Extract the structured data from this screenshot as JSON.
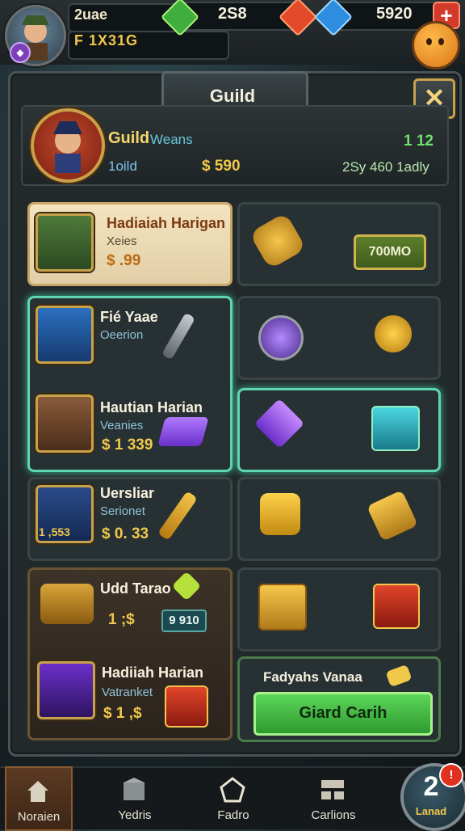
{
  "top_bar": {
    "player_name": "2uae",
    "player_power": "F 1X31G",
    "gold": "2S8",
    "gems": "5920",
    "plus_label": "+"
  },
  "panel": {
    "title": "Guild",
    "close_label": "✕"
  },
  "guild": {
    "name": "Guild",
    "tag": "Weans",
    "members": "1oild",
    "coins": "$ 590",
    "level": "1 12",
    "progress": "2Sy 460 1adly"
  },
  "items": [
    {
      "title": "Hadiaiah Harigan",
      "sub": "Xeies",
      "price": "$ .99"
    },
    {
      "title": "Fié Yaae",
      "sub": "Oeerion"
    },
    {
      "title": "Hautian Harian",
      "sub": "Veanies",
      "price": "$ 1 339"
    },
    {
      "title": "Uersliar",
      "sub": "Serionet",
      "price": "$ 0. 33",
      "badge": "1 ,553"
    },
    {
      "title": "Udd Tarao",
      "price": "1 ;$",
      "chip": "9 910"
    },
    {
      "title": "Hadiiah Harian",
      "sub": "Vatranket",
      "price": "$ 1 ,$"
    }
  ],
  "price_chip": "700MO",
  "offer": {
    "label": "Fadyahs Vanaa",
    "button": "Giard Carih"
  },
  "nav": [
    {
      "label": "Noraien",
      "icon": "home-icon"
    },
    {
      "label": "Yedris",
      "icon": "box-icon"
    },
    {
      "label": "Fadro",
      "icon": "pentagon-icon"
    },
    {
      "label": "Carlions",
      "icon": "grid-icon"
    }
  ],
  "level_badge": {
    "number": "2",
    "label": "Lanad",
    "notification": "!"
  },
  "colors": {
    "accent_gold": "#f0c84a",
    "accent_green": "#5cd65a",
    "panel_bg": "#22292b"
  }
}
